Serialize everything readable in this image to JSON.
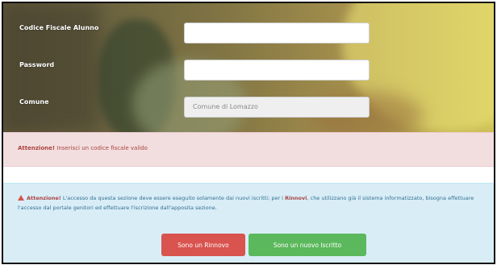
{
  "form": {
    "codice_fiscale_label": "Codice Fiscale Alunno",
    "codice_fiscale_value": "",
    "password_label": "Password",
    "password_value": "",
    "comune_label": "Comune",
    "comune_selected": "Comune di Lomazzo"
  },
  "error_alert": {
    "title": "Attenzione!",
    "message": " Inserisci un codice fiscale valido"
  },
  "info_alert": {
    "title": "Attenzione!",
    "text_before": " L'accesso da questa sezione deve essere eseguito solamente dai nuovi iscritti; per i ",
    "highlight": "Rinnovi",
    "text_after": ", che utilizzano già il sistema informatizzato, bisogna effettuare l'accesso dal portale genitori ed effettuare l'iscrizione dall'apposita sezione."
  },
  "buttons": {
    "rinnovo": "Sono un Rinnovo",
    "nuovo": "Sono un nuovo Iscritto"
  },
  "colors": {
    "error_bg": "#f2dede",
    "info_bg": "#d9edf7",
    "button_red": "#d9534f",
    "button_green": "#5cb85c"
  }
}
